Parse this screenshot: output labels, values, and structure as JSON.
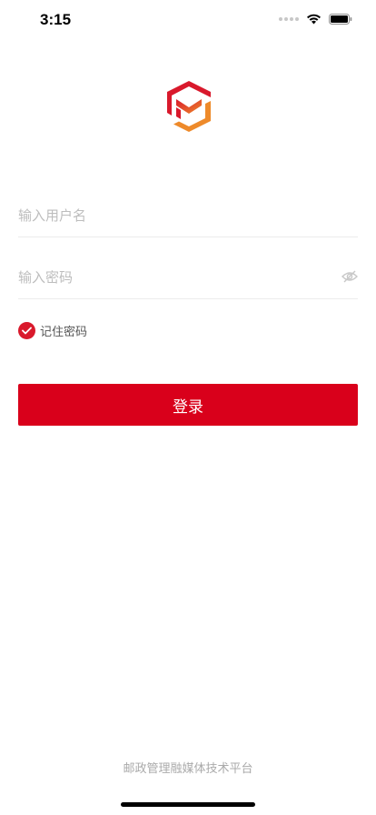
{
  "status_bar": {
    "time": "3:15"
  },
  "logo": {
    "icon": "hexagon-mail-logo",
    "colors": {
      "red": "#d9192c",
      "orange": "#ee8a2a"
    }
  },
  "form": {
    "username": {
      "placeholder": "输入用户名",
      "value": ""
    },
    "password": {
      "placeholder": "输入密码",
      "value": "",
      "toggle_icon": "eye-icon"
    },
    "remember": {
      "label": "记住密码",
      "checked": true
    },
    "login_label": "登录"
  },
  "footer": {
    "text": "邮政管理融媒体技术平台"
  },
  "colors": {
    "accent": "#d9001b",
    "placeholder": "#bdbdbd",
    "divider": "#ececec"
  }
}
